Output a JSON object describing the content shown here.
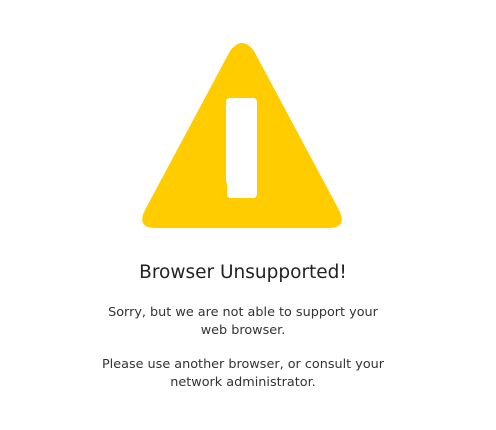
{
  "icon": {
    "name": "warning-icon",
    "color": "#FFCC00",
    "glyph_color": "#FFFFFF"
  },
  "title": "Browser Unsupported!",
  "messages": [
    {
      "lines": [
        "Sorry, but we are not able to support your",
        "web browser."
      ]
    },
    {
      "lines": [
        "Please use another browser, or consult your",
        "network administrator."
      ]
    }
  ]
}
